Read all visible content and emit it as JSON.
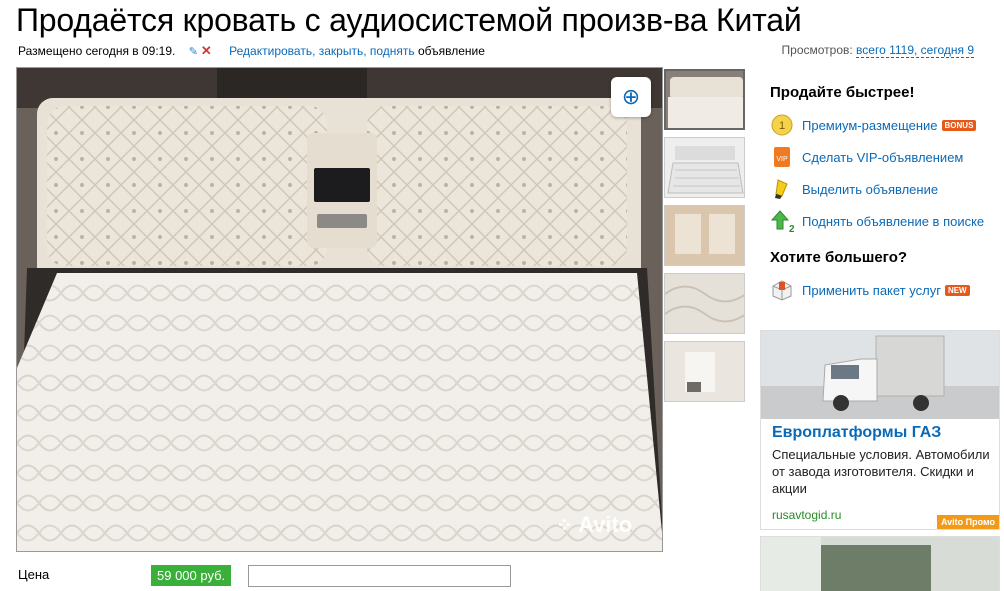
{
  "title": "Продаётся кровать с аудиосистемой произв-ва Китай",
  "meta": {
    "posted": "Размещено сегодня в 09:19.",
    "edit_links": "Редактировать, закрыть, поднять",
    "edit_suffix": "объявление"
  },
  "views": {
    "label": "Просмотров:",
    "total": "всего 1119, сегодня 9"
  },
  "watermark": "Avito",
  "promo": {
    "heading": "Продайте быстрее!",
    "items": [
      {
        "label": "Премиум-размещение",
        "badge": "BONUS",
        "icon": "coin-1-icon"
      },
      {
        "label": "Сделать VIP-объявлением",
        "icon": "vip-icon"
      },
      {
        "label": "Выделить объявление",
        "icon": "highlighter-icon"
      },
      {
        "label": "Поднять объявление в поиске",
        "icon": "arrow-up-2-icon"
      }
    ],
    "heading2": "Хотите большего?",
    "items2": [
      {
        "label": "Применить пакет услуг",
        "badge": "NEW",
        "icon": "package-icon"
      }
    ]
  },
  "ad": {
    "title": "Европлатформы ГАЗ",
    "text": "Специальные условия. Автомобили от завода изготовителя. Скидки и акции",
    "link": "rusavtogid.ru",
    "tag": "Avito Промо"
  },
  "price": {
    "label": "Цена",
    "value": "59 000 руб."
  },
  "colors": {
    "link": "#0a6ab8",
    "price_bg": "#3ab03a",
    "badge": "#e55a1a",
    "promo_tag": "#f29a18"
  }
}
